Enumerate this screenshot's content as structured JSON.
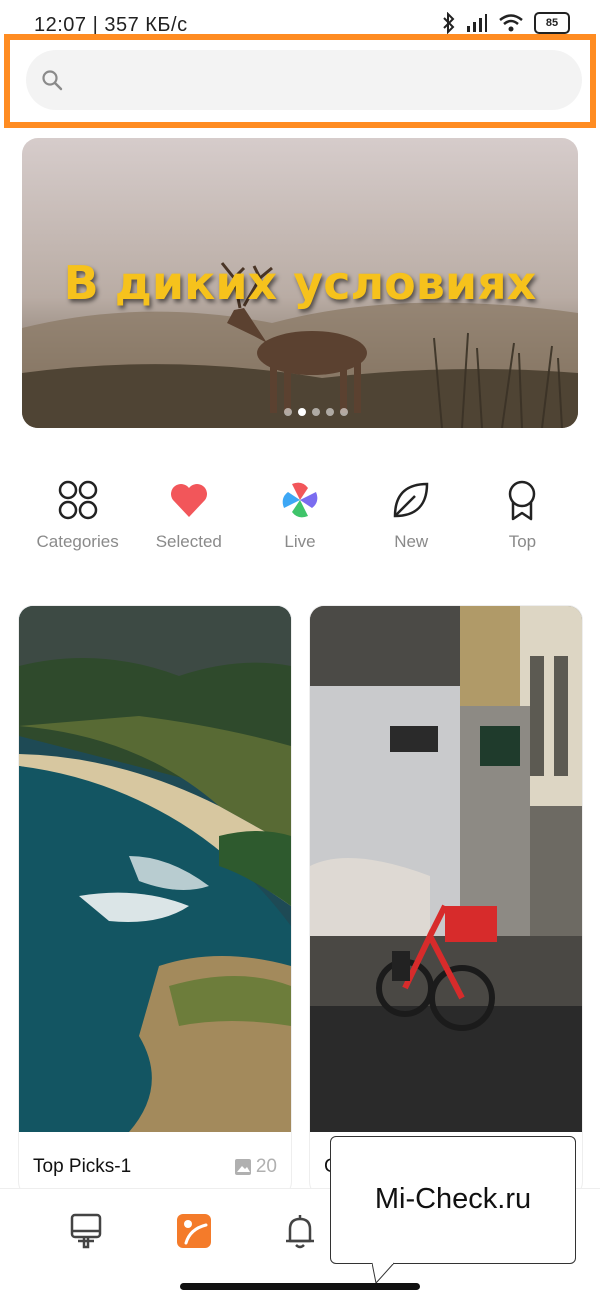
{
  "status_bar": {
    "text": "12:07 | 357 КБ/с",
    "battery": "85"
  },
  "search": {
    "placeholder": ""
  },
  "banner": {
    "title": "В диких условиях",
    "page_count": 5,
    "active_index": 1
  },
  "categories": [
    {
      "label": "Categories",
      "icon": "grid-flower-icon"
    },
    {
      "label": "Selected",
      "icon": "heart-icon"
    },
    {
      "label": "Live",
      "icon": "pinwheel-icon"
    },
    {
      "label": "New",
      "icon": "leaf-icon"
    },
    {
      "label": "Top",
      "icon": "award-ribbon-icon"
    }
  ],
  "cards": [
    {
      "title": "Top Picks-1",
      "count": "20"
    },
    {
      "title": "C"
    }
  ],
  "bottom_nav": [
    {
      "icon": "theme-stand-icon",
      "active": false
    },
    {
      "icon": "wallpaper-icon",
      "active": true
    },
    {
      "icon": "bell-icon",
      "active": false
    }
  ],
  "overlay": {
    "watermark": "Mi-Check.ru"
  },
  "colors": {
    "accent": "#ff8c22",
    "active_tab": "#f47b2a",
    "heart": "#f2565a"
  }
}
